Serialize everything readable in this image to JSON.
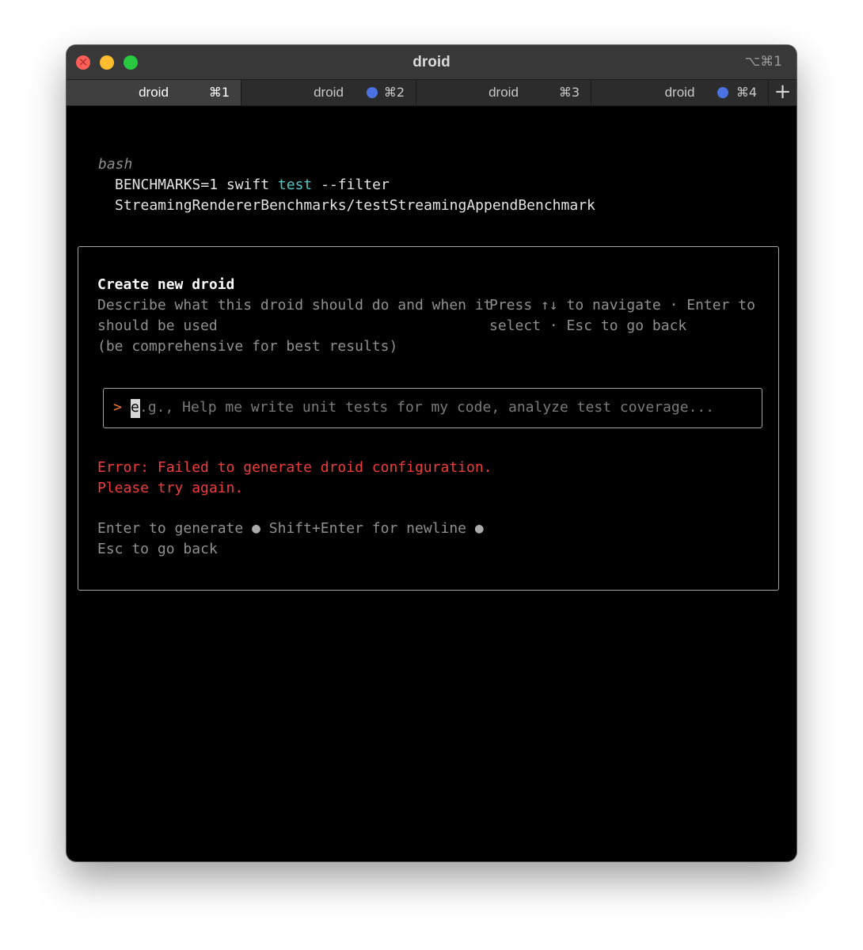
{
  "window": {
    "title": "droid",
    "shortcut": "⌥⌘1"
  },
  "tabs": [
    {
      "label": "droid",
      "shortcut": "⌘1",
      "active": true,
      "activity_dot": false
    },
    {
      "label": "droid",
      "shortcut": "⌘2",
      "active": false,
      "activity_dot": true
    },
    {
      "label": "droid",
      "shortcut": "⌘3",
      "active": false,
      "activity_dot": false
    },
    {
      "label": "droid",
      "shortcut": "⌘4",
      "active": false,
      "activity_dot": true
    }
  ],
  "new_tab_label": "+",
  "terminal": {
    "shell_label": "bash",
    "command": {
      "line1_prefix": "BENCHMARKS=1 swift ",
      "line1_keyword": "test",
      "line1_suffix": " --filter",
      "line2": "StreamingRendererBenchmarks/testStreamingAppendBenchmark"
    }
  },
  "dialog": {
    "title": "Create new droid",
    "description_lines": [
      "Describe what this droid should do and when it",
      "should be used",
      "(be comprehensive for best results)"
    ],
    "hint_lines": [
      "Press ↑↓ to navigate · Enter to",
      "select · Esc to go back"
    ],
    "input": {
      "prompt": ">",
      "cursor_char": "e",
      "placeholder_rest": ".g., Help me write unit tests for my code, analyze test coverage..."
    },
    "error_lines": [
      "Error: Failed to generate droid configuration.",
      "Please try again."
    ],
    "help": {
      "generate": "Enter to generate",
      "newline": "Shift+Enter for newline",
      "back": "Esc to go back",
      "separator": "●"
    }
  },
  "colors": {
    "background": "#000000",
    "keyword": "#56c7c7",
    "prompt": "#f07837",
    "error": "#f03c3c",
    "muted": "#909090",
    "tab_dot": "#4a72e0"
  }
}
